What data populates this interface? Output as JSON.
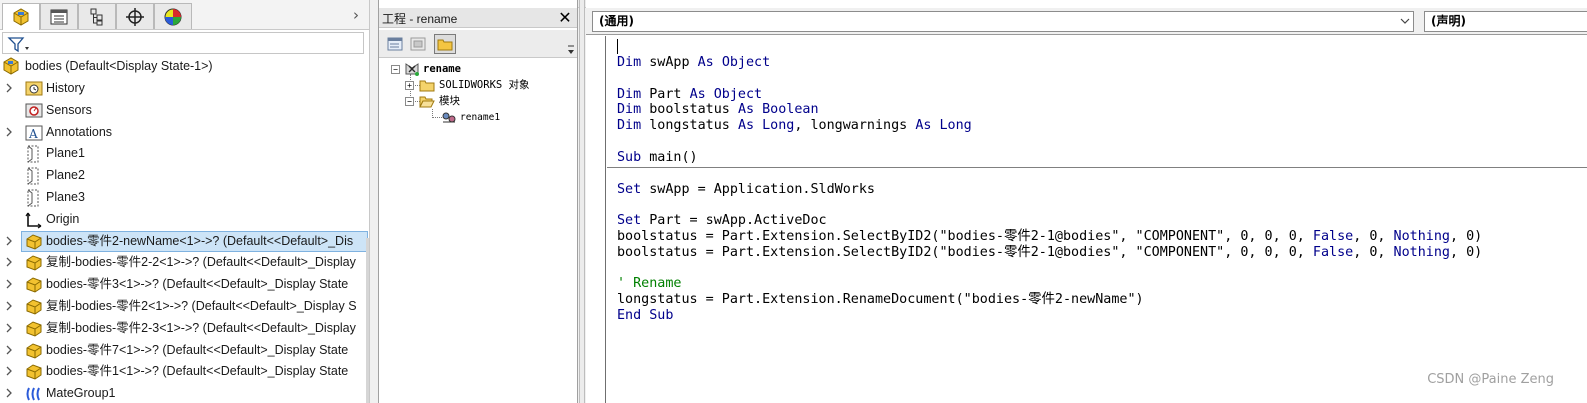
{
  "feature_manager": {
    "tabs": [
      {
        "name": "featuremanager-tab",
        "icon": "assembly-tree-icon"
      },
      {
        "name": "propertymanager-tab",
        "icon": "property-list-icon"
      },
      {
        "name": "configurationmanager-tab",
        "icon": "configuration-icon"
      },
      {
        "name": "dimxpert-tab",
        "icon": "crosshair-icon"
      },
      {
        "name": "display-manager-tab",
        "icon": "appearance-pie-icon"
      }
    ],
    "root": {
      "label": "bodies  (Default<Display State-1>)"
    },
    "items": [
      {
        "label": "History",
        "icon": "history-folder-icon",
        "expandable": true
      },
      {
        "label": "Sensors",
        "icon": "sensor-icon",
        "expandable": false
      },
      {
        "label": "Annotations",
        "icon": "annotation-icon",
        "expandable": true
      },
      {
        "label": "Plane1",
        "icon": "plane-icon",
        "expandable": false
      },
      {
        "label": "Plane2",
        "icon": "plane-icon",
        "expandable": false
      },
      {
        "label": "Plane3",
        "icon": "plane-icon",
        "expandable": false
      },
      {
        "label": "Origin",
        "icon": "origin-icon",
        "expandable": false
      },
      {
        "label": "bodies-零件2-newName<1>->? (Default<<Default>_Dis",
        "icon": "part-icon",
        "expandable": true,
        "selected": true
      },
      {
        "label": "复制-bodies-零件2-2<1>->? (Default<<Default>_Display",
        "icon": "part-icon",
        "expandable": true
      },
      {
        "label": "bodies-零件3<1>->? (Default<<Default>_Display State",
        "icon": "part-icon",
        "expandable": true
      },
      {
        "label": "复制-bodies-零件2<1>->? (Default<<Default>_Display S",
        "icon": "part-icon",
        "expandable": true
      },
      {
        "label": "复制-bodies-零件2-3<1>->? (Default<<Default>_Display",
        "icon": "part-icon",
        "expandable": true
      },
      {
        "label": "bodies-零件7<1>->? (Default<<Default>_Display State",
        "icon": "part-icon",
        "expandable": true
      },
      {
        "label": "bodies-零件1<1>->? (Default<<Default>_Display State",
        "icon": "part-icon",
        "expandable": true
      },
      {
        "label": "MateGroup1",
        "icon": "mategroup-icon",
        "expandable": true
      }
    ]
  },
  "project": {
    "title": "工程 - rename",
    "close_label": "✕",
    "tree": {
      "root": "rename",
      "objects_folder": "SOLIDWORKS 对象",
      "modules_folder": "模块",
      "module": "rename1"
    }
  },
  "code_window": {
    "object_combo": "(通用)",
    "proc_combo": "(声明)",
    "declarations": [
      [
        {
          "t": "Dim",
          "c": "kw"
        },
        {
          "t": " swApp "
        },
        {
          "t": "As",
          "c": "kw"
        },
        {
          "t": " "
        },
        {
          "t": "Object",
          "c": "kw"
        }
      ],
      [],
      [
        {
          "t": "Dim",
          "c": "kw"
        },
        {
          "t": " Part "
        },
        {
          "t": "As",
          "c": "kw"
        },
        {
          "t": " "
        },
        {
          "t": "Object",
          "c": "kw"
        }
      ],
      [
        {
          "t": "Dim",
          "c": "kw"
        },
        {
          "t": " boolstatus "
        },
        {
          "t": "As",
          "c": "kw"
        },
        {
          "t": " "
        },
        {
          "t": "Boolean",
          "c": "kw"
        }
      ],
      [
        {
          "t": "Dim",
          "c": "kw"
        },
        {
          "t": " longstatus "
        },
        {
          "t": "As",
          "c": "kw"
        },
        {
          "t": " "
        },
        {
          "t": "Long",
          "c": "kw"
        },
        {
          "t": ", longwarnings "
        },
        {
          "t": "As",
          "c": "kw"
        },
        {
          "t": " "
        },
        {
          "t": "Long",
          "c": "kw"
        }
      ]
    ],
    "procedure": [
      [
        {
          "t": "Sub",
          "c": "kw"
        },
        {
          "t": " main()"
        }
      ],
      [],
      [
        {
          "t": "Set",
          "c": "kw"
        },
        {
          "t": " swApp = Application.SldWorks"
        }
      ],
      [],
      [
        {
          "t": "Set",
          "c": "kw"
        },
        {
          "t": " Part = swApp.ActiveDoc"
        }
      ],
      [
        {
          "t": "boolstatus = Part.Extension.SelectByID2(\"bodies-零件2-1@bodies\", \"COMPONENT\", 0, 0, 0, "
        },
        {
          "t": "False",
          "c": "kw"
        },
        {
          "t": ", 0, "
        },
        {
          "t": "Nothing",
          "c": "kw"
        },
        {
          "t": ", 0)"
        }
      ],
      [
        {
          "t": "boolstatus = Part.Extension.SelectByID2(\"bodies-零件2-1@bodies\", \"COMPONENT\", 0, 0, 0, "
        },
        {
          "t": "False",
          "c": "kw"
        },
        {
          "t": ", 0, "
        },
        {
          "t": "Nothing",
          "c": "kw"
        },
        {
          "t": ", 0)"
        }
      ],
      [],
      [
        {
          "t": "' Rename",
          "c": "cm"
        }
      ],
      [
        {
          "t": "longstatus = Part.Extension.RenameDocument(\"bodies-零件2-newName\")"
        }
      ],
      [
        {
          "t": "End Sub",
          "c": "kw"
        }
      ]
    ]
  },
  "watermark": "CSDN @Paine Zeng",
  "colors": {
    "keyword": "#00008b",
    "comment": "#008000",
    "selection": "#cde4f7"
  }
}
